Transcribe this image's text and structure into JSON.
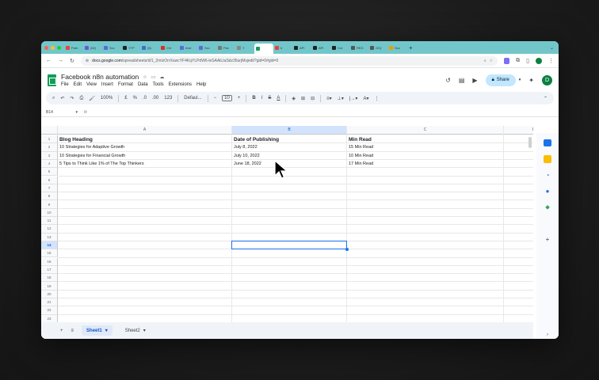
{
  "browser": {
    "tabs": [
      {
        "label": "Partı",
        "color": "#e8453c"
      },
      {
        "label": "(62)",
        "color": "#6e55d8"
      },
      {
        "label": "Scc",
        "color": "#5b6bd6"
      },
      {
        "label": "YTP",
        "color": "#222222"
      },
      {
        "label": "(6)",
        "color": "#4a6bd6"
      },
      {
        "label": "Chr",
        "color": "#d93025"
      },
      {
        "label": "Inve",
        "color": "#5b6bd6"
      },
      {
        "label": "Scc",
        "color": "#5b6bd6"
      },
      {
        "label": "Pav",
        "color": "#777777"
      },
      {
        "label": "Y",
        "color": "#888888"
      },
      {
        "label": "",
        "color": "#0f9d58",
        "active": true
      },
      {
        "label": "h",
        "color": "#ea4335"
      },
      {
        "label": "API",
        "color": "#222222"
      },
      {
        "label": "API",
        "color": "#222222"
      },
      {
        "label": "Cre",
        "color": "#222222"
      },
      {
        "label": "REG",
        "color": "#555555"
      },
      {
        "label": "GO(",
        "color": "#555555"
      },
      {
        "label": "Sco",
        "color": "#e3a300"
      }
    ],
    "url_domain": "docs.google.com",
    "url_path": "/spreadsheets/d/1_2mIzOrrXuwcYF4KqYLPdW6-leSAAiLIaSdz35urjMsjedit?gid=0#gid=0"
  },
  "sheets": {
    "title": "Facebook n8n automation",
    "menu": [
      "File",
      "Edit",
      "View",
      "Insert",
      "Format",
      "Data",
      "Tools",
      "Extensions",
      "Help"
    ],
    "share_label": "Share",
    "avatar_letter": "D",
    "toolbar": {
      "zoom": "100%",
      "currency": "£",
      "percent": "%",
      "dec_less": ".0",
      "dec_more": ".00",
      "number_format": "123",
      "font": "Defaul...",
      "font_size": "10"
    },
    "namebox": "B14",
    "fx_label": "fx",
    "columns": [
      "A",
      "B",
      "C",
      "D"
    ],
    "rows": [
      "1",
      "2",
      "3",
      "4",
      "5",
      "6",
      "7",
      "8",
      "9",
      "10",
      "11",
      "12",
      "13",
      "14",
      "15",
      "16",
      "17",
      "18",
      "19",
      "20",
      "21",
      "22",
      "23"
    ],
    "headers": [
      "Blog Heading",
      "Date of Publishing",
      "Min Read"
    ],
    "data": [
      [
        "10 Strategies for Adaptive Growth",
        "July 8, 2022",
        "15 Min Read"
      ],
      [
        "10 Strategies for Financial Growth",
        "July 10, 2022",
        "10 Min Read"
      ],
      [
        "5 Tips to Think Like 1% of The Top Thinkers",
        "June 18, 2022",
        "17 Min Read"
      ]
    ],
    "sheet_tabs": [
      "Sheet1",
      "Sheet2"
    ]
  }
}
